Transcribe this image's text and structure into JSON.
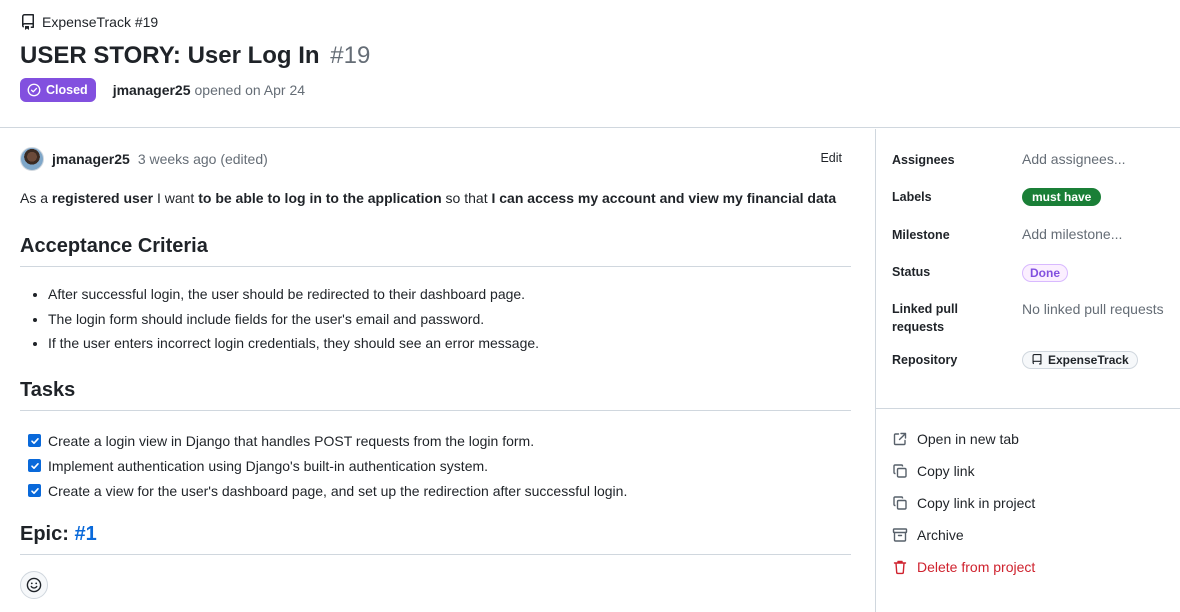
{
  "header": {
    "repo_crumb": "ExpenseTrack #19",
    "title": "USER STORY: User Log In",
    "number": "#19",
    "state": "Closed",
    "author": "jmanager25",
    "opened_text": "opened on Apr 24"
  },
  "comment": {
    "author": "jmanager25",
    "time": "3 weeks ago (edited)",
    "edit_label": "Edit",
    "story": {
      "p1": "As a ",
      "b1": "registered user",
      "p2": " I want ",
      "b2": "to be able to log in to the application",
      "p3": " so that ",
      "b3": "I can access my account and view my financial data"
    },
    "acceptance_heading": "Acceptance Criteria",
    "criteria": [
      "After successful login, the user should be redirected to their dashboard page.",
      "The login form should include fields for the user's email and password.",
      "If the user enters incorrect login credentials, they should see an error message."
    ],
    "tasks_heading": "Tasks",
    "tasks": [
      {
        "label": "Create a login view in Django that handles POST requests from the login form.",
        "checked": true
      },
      {
        "label": "Implement authentication using Django's built-in authentication system.",
        "checked": true
      },
      {
        "label": "Create a view for the user's dashboard page, and set up the redirection after successful login.",
        "checked": true
      }
    ],
    "epic_label": "Epic: ",
    "epic_link": "#1"
  },
  "sidebar": {
    "assignees_key": "Assignees",
    "assignees_val": "Add assignees...",
    "labels_key": "Labels",
    "label_must": "must have",
    "milestone_key": "Milestone",
    "milestone_val": "Add milestone...",
    "status_key": "Status",
    "status_val": "Done",
    "linked_key_1": "Linked pull",
    "linked_key_2": "requests",
    "linked_val": "No linked pull requests",
    "repository_key": "Repository",
    "repository_val": "ExpenseTrack",
    "actions": {
      "open_new_tab": "Open in new tab",
      "copy_link": "Copy link",
      "copy_link_project": "Copy link in project",
      "archive": "Archive",
      "delete": "Delete from project"
    }
  },
  "colors": {
    "closed_purple": "#8250df",
    "label_green": "#1a7f37",
    "link_blue": "#0969da",
    "danger_red": "#cf222e"
  }
}
